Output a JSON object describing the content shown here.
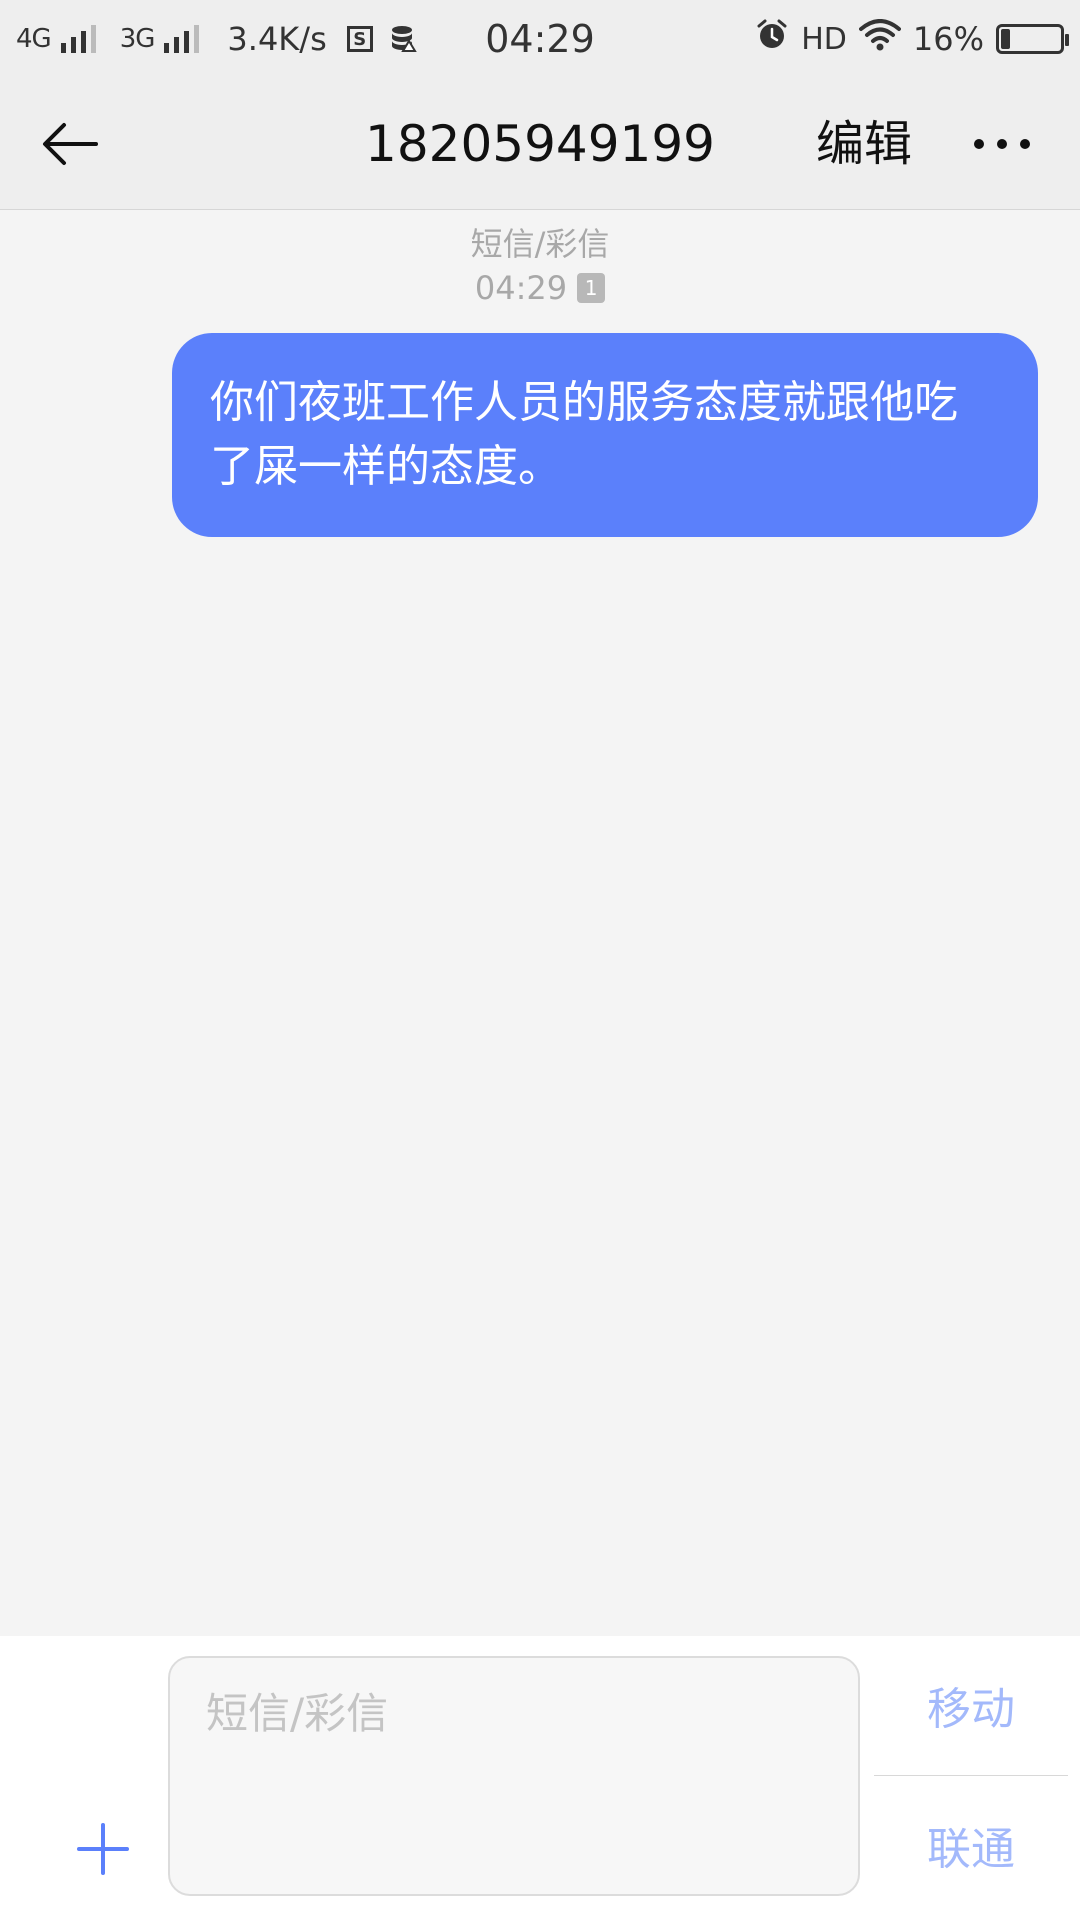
{
  "status_bar": {
    "net1": "4G",
    "net2": "3G",
    "speed": "3.4K/s",
    "box_icon_letter": "S",
    "time": "04:29",
    "hd": "HD",
    "battery_pct": "16%",
    "battery_level": 0.16
  },
  "header": {
    "title": "18205949199",
    "edit_label": "编辑"
  },
  "conversation": {
    "messages": [
      {
        "type_label": "短信/彩信",
        "time": "04:29",
        "sim_badge": "1",
        "text": "你们夜班工作人员的服务态度就跟他吃了屎一样的态度。",
        "direction": "outgoing"
      }
    ]
  },
  "compose": {
    "placeholder": "短信/彩信",
    "send_sim1_label": "移动",
    "send_sim2_label": "联通"
  },
  "colors": {
    "bubble": "#5b80fb",
    "accent": "#5b80fb",
    "send_label": "#a3b9fb",
    "meta_text": "#a8a8a8"
  },
  "icons": {
    "back": "arrow-left-icon",
    "more": "more-dots-icon",
    "add": "plus-icon",
    "alarm": "alarm-clock-icon",
    "wifi": "wifi-icon",
    "battery": "battery-icon",
    "sim_storage": "sim-card-icon",
    "data": "database-icon"
  }
}
